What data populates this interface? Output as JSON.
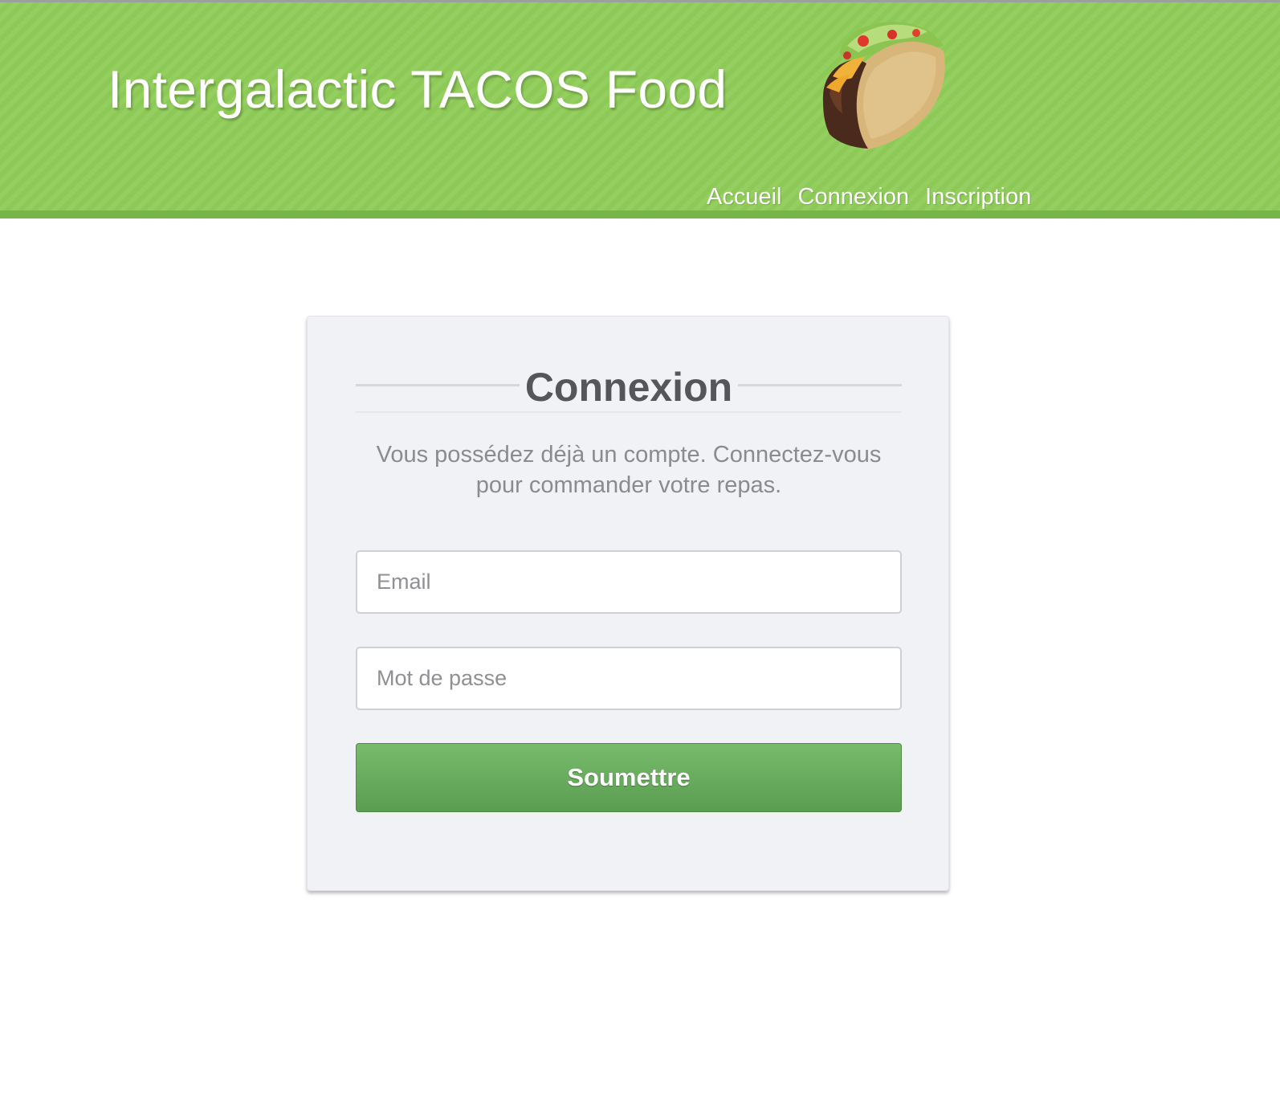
{
  "header": {
    "title": "Intergalactic TACOS Food",
    "logo_icon": "taco-icon",
    "background_color": "#8fcc57",
    "nav": [
      {
        "label": "Accueil"
      },
      {
        "label": "Connexion"
      },
      {
        "label": "Inscription"
      }
    ]
  },
  "login": {
    "heading": "Connexion",
    "subtitle": "Vous possédez déjà un compte. Connectez-vous pour commander votre repas.",
    "email": {
      "placeholder": "Email",
      "value": ""
    },
    "password": {
      "placeholder": "Mot de passe",
      "value": ""
    },
    "submit_label": "Soumettre",
    "submit_color": "#5fa355"
  }
}
